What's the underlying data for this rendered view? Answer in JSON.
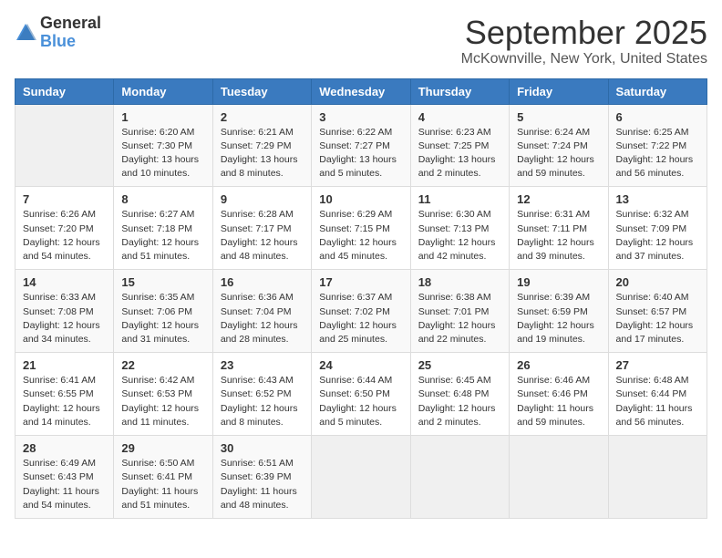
{
  "logo": {
    "text_general": "General",
    "text_blue": "Blue"
  },
  "title": "September 2025",
  "location": "McKownville, New York, United States",
  "days_of_week": [
    "Sunday",
    "Monday",
    "Tuesday",
    "Wednesday",
    "Thursday",
    "Friday",
    "Saturday"
  ],
  "weeks": [
    [
      {
        "day": "",
        "info": ""
      },
      {
        "day": "1",
        "info": "Sunrise: 6:20 AM\nSunset: 7:30 PM\nDaylight: 13 hours\nand 10 minutes."
      },
      {
        "day": "2",
        "info": "Sunrise: 6:21 AM\nSunset: 7:29 PM\nDaylight: 13 hours\nand 8 minutes."
      },
      {
        "day": "3",
        "info": "Sunrise: 6:22 AM\nSunset: 7:27 PM\nDaylight: 13 hours\nand 5 minutes."
      },
      {
        "day": "4",
        "info": "Sunrise: 6:23 AM\nSunset: 7:25 PM\nDaylight: 13 hours\nand 2 minutes."
      },
      {
        "day": "5",
        "info": "Sunrise: 6:24 AM\nSunset: 7:24 PM\nDaylight: 12 hours\nand 59 minutes."
      },
      {
        "day": "6",
        "info": "Sunrise: 6:25 AM\nSunset: 7:22 PM\nDaylight: 12 hours\nand 56 minutes."
      }
    ],
    [
      {
        "day": "7",
        "info": "Sunrise: 6:26 AM\nSunset: 7:20 PM\nDaylight: 12 hours\nand 54 minutes."
      },
      {
        "day": "8",
        "info": "Sunrise: 6:27 AM\nSunset: 7:18 PM\nDaylight: 12 hours\nand 51 minutes."
      },
      {
        "day": "9",
        "info": "Sunrise: 6:28 AM\nSunset: 7:17 PM\nDaylight: 12 hours\nand 48 minutes."
      },
      {
        "day": "10",
        "info": "Sunrise: 6:29 AM\nSunset: 7:15 PM\nDaylight: 12 hours\nand 45 minutes."
      },
      {
        "day": "11",
        "info": "Sunrise: 6:30 AM\nSunset: 7:13 PM\nDaylight: 12 hours\nand 42 minutes."
      },
      {
        "day": "12",
        "info": "Sunrise: 6:31 AM\nSunset: 7:11 PM\nDaylight: 12 hours\nand 39 minutes."
      },
      {
        "day": "13",
        "info": "Sunrise: 6:32 AM\nSunset: 7:09 PM\nDaylight: 12 hours\nand 37 minutes."
      }
    ],
    [
      {
        "day": "14",
        "info": "Sunrise: 6:33 AM\nSunset: 7:08 PM\nDaylight: 12 hours\nand 34 minutes."
      },
      {
        "day": "15",
        "info": "Sunrise: 6:35 AM\nSunset: 7:06 PM\nDaylight: 12 hours\nand 31 minutes."
      },
      {
        "day": "16",
        "info": "Sunrise: 6:36 AM\nSunset: 7:04 PM\nDaylight: 12 hours\nand 28 minutes."
      },
      {
        "day": "17",
        "info": "Sunrise: 6:37 AM\nSunset: 7:02 PM\nDaylight: 12 hours\nand 25 minutes."
      },
      {
        "day": "18",
        "info": "Sunrise: 6:38 AM\nSunset: 7:01 PM\nDaylight: 12 hours\nand 22 minutes."
      },
      {
        "day": "19",
        "info": "Sunrise: 6:39 AM\nSunset: 6:59 PM\nDaylight: 12 hours\nand 19 minutes."
      },
      {
        "day": "20",
        "info": "Sunrise: 6:40 AM\nSunset: 6:57 PM\nDaylight: 12 hours\nand 17 minutes."
      }
    ],
    [
      {
        "day": "21",
        "info": "Sunrise: 6:41 AM\nSunset: 6:55 PM\nDaylight: 12 hours\nand 14 minutes."
      },
      {
        "day": "22",
        "info": "Sunrise: 6:42 AM\nSunset: 6:53 PM\nDaylight: 12 hours\nand 11 minutes."
      },
      {
        "day": "23",
        "info": "Sunrise: 6:43 AM\nSunset: 6:52 PM\nDaylight: 12 hours\nand 8 minutes."
      },
      {
        "day": "24",
        "info": "Sunrise: 6:44 AM\nSunset: 6:50 PM\nDaylight: 12 hours\nand 5 minutes."
      },
      {
        "day": "25",
        "info": "Sunrise: 6:45 AM\nSunset: 6:48 PM\nDaylight: 12 hours\nand 2 minutes."
      },
      {
        "day": "26",
        "info": "Sunrise: 6:46 AM\nSunset: 6:46 PM\nDaylight: 11 hours\nand 59 minutes."
      },
      {
        "day": "27",
        "info": "Sunrise: 6:48 AM\nSunset: 6:44 PM\nDaylight: 11 hours\nand 56 minutes."
      }
    ],
    [
      {
        "day": "28",
        "info": "Sunrise: 6:49 AM\nSunset: 6:43 PM\nDaylight: 11 hours\nand 54 minutes."
      },
      {
        "day": "29",
        "info": "Sunrise: 6:50 AM\nSunset: 6:41 PM\nDaylight: 11 hours\nand 51 minutes."
      },
      {
        "day": "30",
        "info": "Sunrise: 6:51 AM\nSunset: 6:39 PM\nDaylight: 11 hours\nand 48 minutes."
      },
      {
        "day": "",
        "info": ""
      },
      {
        "day": "",
        "info": ""
      },
      {
        "day": "",
        "info": ""
      },
      {
        "day": "",
        "info": ""
      }
    ]
  ]
}
